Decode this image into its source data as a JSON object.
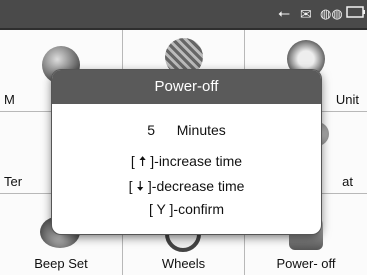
{
  "status_bar": {
    "icons": [
      "usb-icon",
      "mail-icon",
      "link-icon",
      "battery-icon"
    ]
  },
  "menu": {
    "items": [
      {
        "label": "M",
        "icon": "globe-icon"
      },
      {
        "label": "",
        "icon": "grid-globe-icon"
      },
      {
        "label": "Unit",
        "icon": "gauge-icon"
      },
      {
        "label": "Ter",
        "icon": ""
      },
      {
        "label": "",
        "icon": ""
      },
      {
        "label": "at",
        "icon": "format-icon"
      },
      {
        "label": "Beep Set",
        "icon": "beep-icon"
      },
      {
        "label": "Wheels",
        "icon": "wheel-icon"
      },
      {
        "label": "Power- off",
        "icon": "power-icon"
      }
    ]
  },
  "dialog": {
    "title": "Power-off",
    "value": "5",
    "unit": "Minutes",
    "line_increase": "]-increase time",
    "line_decrease": "]-decrease time",
    "line_confirm_key": "Y",
    "line_confirm": "]-confirm"
  }
}
